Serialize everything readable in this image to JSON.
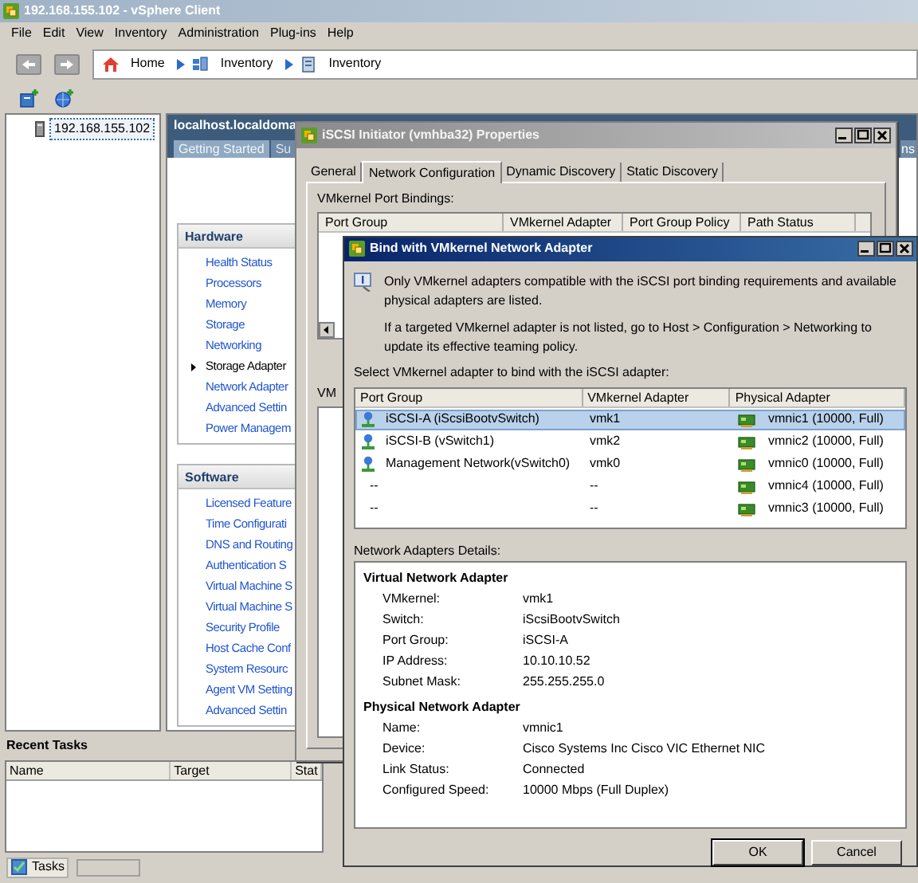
{
  "window": {
    "title": "192.168.155.102 - vSphere Client"
  },
  "menu": [
    "File",
    "Edit",
    "View",
    "Inventory",
    "Administration",
    "Plug-ins",
    "Help"
  ],
  "breadcrumb": [
    {
      "label": "Home",
      "kind": "home"
    },
    {
      "label": "Inventory",
      "kind": "hosts"
    },
    {
      "label": "Inventory",
      "kind": "host"
    }
  ],
  "tree": {
    "items": [
      {
        "label": "192.168.155.102",
        "selected": true
      }
    ]
  },
  "host_panel": {
    "title": "localhost.localdoma",
    "tabs": [
      {
        "label": "Getting Started",
        "selected": true
      },
      {
        "label": "Su",
        "selected": false
      }
    ],
    "right_tab": "ns",
    "sections": [
      {
        "title": "Hardware",
        "items": [
          {
            "label": "Health Status",
            "selected": false
          },
          {
            "label": "Processors",
            "selected": false
          },
          {
            "label": "Memory",
            "selected": false
          },
          {
            "label": "Storage",
            "selected": false
          },
          {
            "label": "Networking",
            "selected": false
          },
          {
            "label": "Storage Adapter",
            "selected": true
          },
          {
            "label": "Network Adapter",
            "selected": false
          },
          {
            "label": "Advanced Settin",
            "selected": false
          },
          {
            "label": "Power Managem",
            "selected": false
          }
        ]
      },
      {
        "title": "Software",
        "items": [
          {
            "label": "Licensed Feature",
            "selected": false
          },
          {
            "label": "Time Configurati",
            "selected": false
          },
          {
            "label": "DNS and Routing",
            "selected": false
          },
          {
            "label": "Authentication S",
            "selected": false
          },
          {
            "label": "Virtual Machine S",
            "selected": false
          },
          {
            "label": "Virtual Machine S",
            "selected": false
          },
          {
            "label": "Security Profile",
            "selected": false
          },
          {
            "label": "Host Cache Conf",
            "selected": false
          },
          {
            "label": "System Resourc",
            "selected": false
          },
          {
            "label": "Agent VM Setting",
            "selected": false
          },
          {
            "label": "Advanced Settin",
            "selected": false
          }
        ]
      }
    ]
  },
  "recent_tasks": {
    "title": "Recent Tasks",
    "columns": [
      "Name",
      "Target",
      "Stat"
    ]
  },
  "status_bar": {
    "tasks_button": "Tasks"
  },
  "iscsi_dialog": {
    "title": "iSCSI Initiator (vmhba32) Properties",
    "tabs": [
      {
        "label": "General",
        "selected": false
      },
      {
        "label": "Network Configuration",
        "selected": true
      },
      {
        "label": "Dynamic Discovery",
        "selected": false
      },
      {
        "label": "Static Discovery",
        "selected": false
      }
    ],
    "bindings_label": "VMkernel Port Bindings:",
    "columns": [
      "Port Group",
      "VMkernel Adapter",
      "Port Group Policy",
      "Path Status"
    ],
    "lower_label": "VM"
  },
  "bind_dialog": {
    "title": "Bind with VMkernel Network Adapter",
    "info": [
      "Only VMkernel adapters compatible with the iSCSI port binding requirements and available physical adapters are listed.",
      "If a targeted VMkernel adapter is not listed, go to Host > Configuration > Networking to update its effective teaming policy."
    ],
    "select_label": "Select VMkernel adapter to bind with the iSCSI adapter:",
    "columns": [
      "Port Group",
      "VMkernel Adapter",
      "Physical Adapter"
    ],
    "rows": [
      {
        "kind": "vmkernel",
        "port_group": "iSCSI-A (iScsiBootvSwitch)",
        "vmkernel_adapter": "vmk1",
        "physical_adapter": "vmnic1 (10000, Full)",
        "selected": true
      },
      {
        "kind": "vmkernel",
        "port_group": "iSCSI-B (vSwitch1)",
        "vmkernel_adapter": "vmk2",
        "physical_adapter": "vmnic2 (10000, Full)",
        "selected": false
      },
      {
        "kind": "vmkernel",
        "port_group": "Management Network(vSwitch0)",
        "vmkernel_adapter": "vmk0",
        "physical_adapter": "vmnic0 (10000, Full)",
        "selected": false
      },
      {
        "kind": "none",
        "port_group": "--",
        "vmkernel_adapter": "--",
        "physical_adapter": "vmnic4 (10000, Full)",
        "selected": false
      },
      {
        "kind": "none",
        "port_group": "--",
        "vmkernel_adapter": "--",
        "physical_adapter": "vmnic3 (10000, Full)",
        "selected": false
      }
    ],
    "details_label": "Network Adapters Details:",
    "details": [
      {
        "heading": "Virtual Network Adapter",
        "fields": [
          {
            "label": "VMkernel:",
            "value": "vmk1"
          },
          {
            "label": "Switch:",
            "value": "iScsiBootvSwitch"
          },
          {
            "label": "Port Group:",
            "value": "iSCSI-A"
          },
          {
            "label": "IP Address:",
            "value": "10.10.10.52"
          },
          {
            "label": "Subnet Mask:",
            "value": "255.255.255.0"
          }
        ]
      },
      {
        "heading": "Physical Network Adapter",
        "fields": [
          {
            "label": "Name:",
            "value": "vmnic1"
          },
          {
            "label": "Device:",
            "value": "Cisco Systems Inc Cisco VIC Ethernet NIC"
          },
          {
            "label": "Link Status:",
            "value": "Connected"
          },
          {
            "label": "Configured Speed:",
            "value": "10000 Mbps (Full Duplex)"
          }
        ]
      }
    ],
    "buttons": [
      "OK",
      "Cancel"
    ]
  }
}
